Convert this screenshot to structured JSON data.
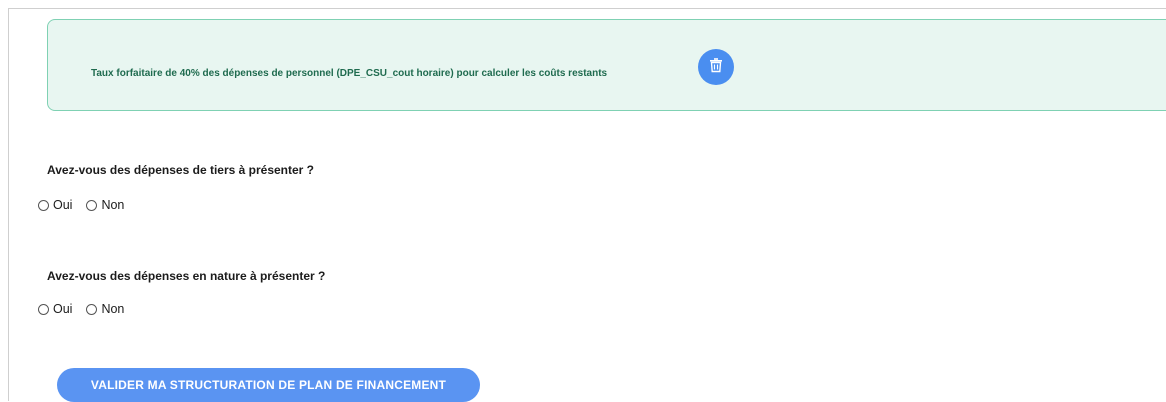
{
  "info_box": {
    "text": "Taux forfaitaire de 40% des dépenses de personnel (DPE_CSU_cout horaire) pour calculer les coûts restants",
    "delete_icon": "trash-icon"
  },
  "questions": [
    {
      "label": "Avez-vous des dépenses de tiers à présenter ?",
      "options": [
        "Oui",
        "Non"
      ]
    },
    {
      "label": "Avez-vous des dépenses en nature à présenter ?",
      "options": [
        "Oui",
        "Non"
      ]
    }
  ],
  "submit": {
    "label": "VALIDER MA STRUCTURATION DE PLAN DE FINANCEMENT"
  },
  "colors": {
    "info_bg": "#e8f6f1",
    "info_border": "#7fd1b3",
    "info_text": "#1f6b4f",
    "accent": "#5a94f2"
  }
}
